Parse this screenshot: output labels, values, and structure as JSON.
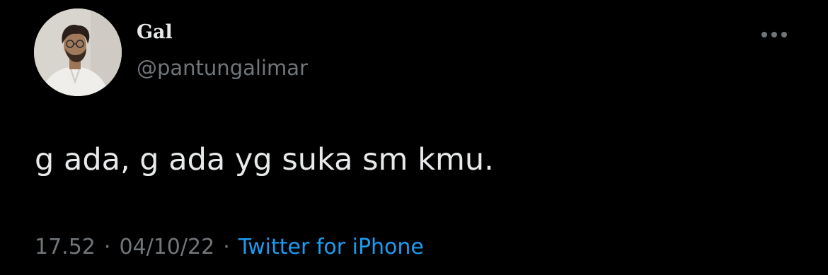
{
  "tweet": {
    "author": {
      "display_name": "Gal",
      "handle": "@pantungalimar",
      "avatar_icon": "profile-photo"
    },
    "more_icon": "ellipsis-icon",
    "text": "g ada, g ada yg suka sm kmu.",
    "meta": {
      "time": "17.52",
      "separator": "·",
      "date": "04/10/22",
      "source": "Twitter for iPhone"
    }
  },
  "colors": {
    "background": "#000000",
    "primary_text": "#e7e9ea",
    "secondary_text": "#71767b",
    "link": "#1d9bf0"
  }
}
